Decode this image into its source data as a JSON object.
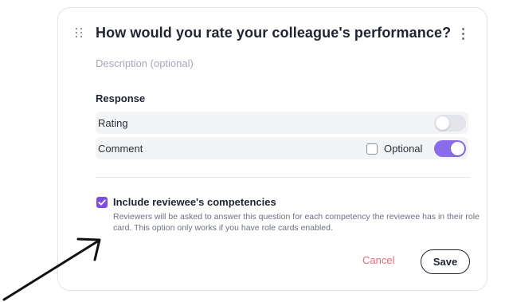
{
  "question": {
    "title": "How would you rate your colleague's performance?",
    "description_placeholder": "Description (optional)"
  },
  "response": {
    "label": "Response",
    "rows": [
      {
        "label": "Rating",
        "enabled": false
      },
      {
        "label": "Comment",
        "enabled": true,
        "optional_label": "Optional",
        "optional_checked": false
      }
    ]
  },
  "competencies": {
    "checked": true,
    "title": "Include reviewee's competencies",
    "description": "Reviewers will be asked to answer this question for each competency the reviewee has in their role card. This option only works if you have role cards enabled."
  },
  "actions": {
    "cancel_label": "Cancel",
    "save_label": "Save"
  },
  "colors": {
    "accent": "#7c4ddf",
    "toggle_on": "#8b6ce8",
    "cancel": "#e56b7a"
  }
}
